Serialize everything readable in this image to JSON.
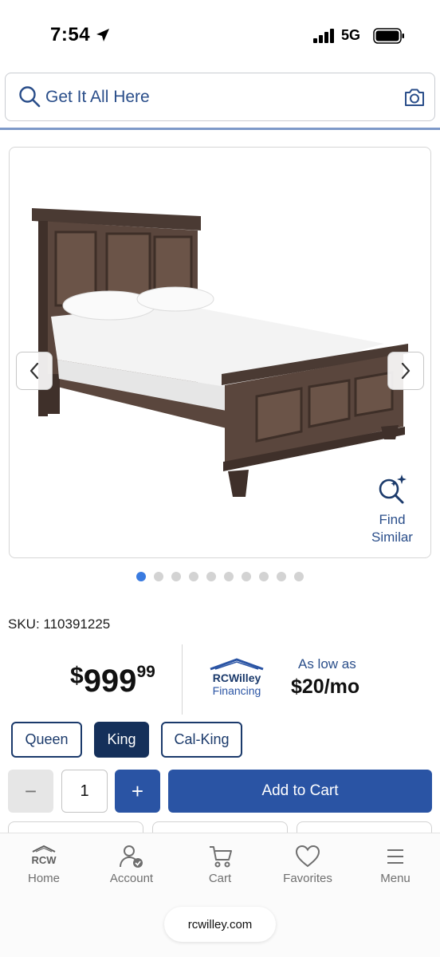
{
  "status_bar": {
    "time": "7:54",
    "network": "5G",
    "icons": [
      "location-arrow-icon",
      "signal-bars-icon",
      "battery-icon"
    ]
  },
  "search": {
    "placeholder": "Get It All Here",
    "icons": [
      "search-icon",
      "camera-icon"
    ]
  },
  "gallery": {
    "image_subject": "wooden panel bed",
    "find_similar_line1": "Find",
    "find_similar_line2": "Similar",
    "dot_count": 10,
    "active_dot": 0
  },
  "product": {
    "sku": "SKU: 110391225",
    "price_currency": "$",
    "price_dollars": "999",
    "price_cents": "99",
    "financing_brand_line1": "RCWilley",
    "financing_brand_line2": "Financing",
    "financing_as_low": "As low as",
    "financing_amount": "$20/mo"
  },
  "sizes": [
    {
      "label": "Queen",
      "selected": false
    },
    {
      "label": "King",
      "selected": true
    },
    {
      "label": "Cal-King",
      "selected": false
    }
  ],
  "cart": {
    "minus": "−",
    "quantity": "1",
    "plus": "+",
    "add_label": "Add to Cart"
  },
  "nav": {
    "items": [
      {
        "label": "Home",
        "icon": "rcw-home-icon",
        "logo_text": "RCW"
      },
      {
        "label": "Account",
        "icon": "account-icon"
      },
      {
        "label": "Cart",
        "icon": "cart-icon"
      },
      {
        "label": "Favorites",
        "icon": "heart-icon"
      },
      {
        "label": "Menu",
        "icon": "menu-icon"
      }
    ],
    "url": "rcwilley.com"
  },
  "colors": {
    "brand_blue": "#2a54a4",
    "navy": "#15305a",
    "link_blue": "#2a4e8a",
    "active_dot": "#3a7be0"
  }
}
